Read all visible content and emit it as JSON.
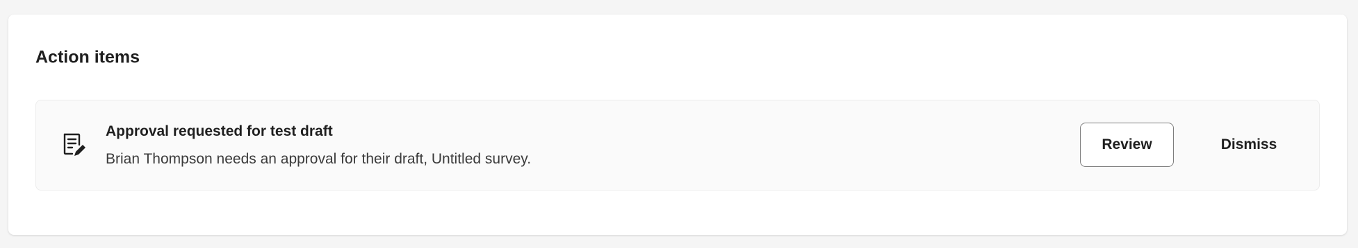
{
  "action_items": {
    "title": "Action items",
    "items": [
      {
        "icon": "document-edit-icon",
        "title": "Approval requested for test draft",
        "description": "Brian Thompson needs an approval for their draft, Untitled survey.",
        "review_label": "Review",
        "dismiss_label": "Dismiss"
      }
    ]
  },
  "colors": {
    "background": "#f5f5f5",
    "panel": "#ffffff",
    "card": "#fafafa",
    "text": "#1f1f1f",
    "button_border": "#7d7d7d"
  }
}
